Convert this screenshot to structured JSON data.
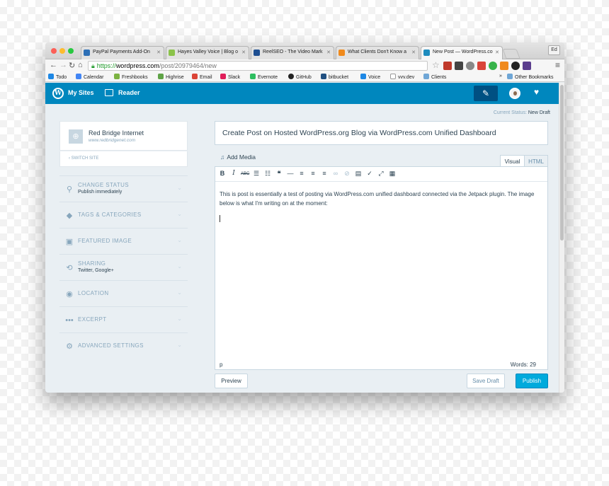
{
  "browser": {
    "tabs": [
      {
        "label": "PayPal Payments Add-On",
        "color": "#2d6fb6"
      },
      {
        "label": "Hayes Valley Voice | Blog o",
        "color": "#8bc34a"
      },
      {
        "label": "ReelSEO - The Video Mark",
        "color": "#1e4f91"
      },
      {
        "label": "What Clients Don't Know a",
        "color": "#f08a1c"
      },
      {
        "label": "New Post — WordPress.co",
        "color": "#1e8cbe"
      }
    ],
    "profile": "Ed",
    "url": {
      "scheme": "https://",
      "host": "wordpress.com",
      "path": "/post/20979464/new"
    },
    "bookmarks": [
      "Todo",
      "Calendar",
      "Freshbooks",
      "Highrise",
      "Email",
      "Slack",
      "Evernote",
      "GitHub",
      "bitbucket",
      "Voice",
      "vvv.dev",
      "Clients"
    ],
    "bookmarks_overflow": "»",
    "other_bookmarks": "Other Bookmarks"
  },
  "masterbar": {
    "my_sites": "My Sites",
    "reader": "Reader"
  },
  "status": {
    "label": "Current Status:",
    "value": "New Draft"
  },
  "site": {
    "name": "Red Bridge Internet",
    "url": "www.redbridgenet.com",
    "switch_label": "SWITCH SITE"
  },
  "sidebar": [
    {
      "title": "CHANGE STATUS",
      "subtitle": "Publish immediately",
      "icon": "pin-icon"
    },
    {
      "title": "TAGS & CATEGORIES",
      "subtitle": "",
      "icon": "tag-icon"
    },
    {
      "title": "FEATURED IMAGE",
      "subtitle": "",
      "icon": "image-icon"
    },
    {
      "title": "SHARING",
      "subtitle": "Twitter, Google+",
      "icon": "share-icon"
    },
    {
      "title": "LOCATION",
      "subtitle": "",
      "icon": "location-icon"
    },
    {
      "title": "EXCERPT",
      "subtitle": "",
      "icon": "ellipsis-icon"
    },
    {
      "title": "ADVANCED SETTINGS",
      "subtitle": "",
      "icon": "cog-icon"
    }
  ],
  "editor": {
    "title": "Create Post on Hosted WordPress.org Blog via WordPress.com Unified Dashboard",
    "add_media": "Add Media",
    "mode_visual": "Visual",
    "mode_html": "HTML",
    "content": "This is post is essentially a test of posting via WordPress.com unified dashboard connected via the Jetpack plugin. The image below is what I'm writing on at the moment:",
    "path": "p",
    "word_count": "Words: 29"
  },
  "actions": {
    "preview": "Preview",
    "save_draft": "Save Draft",
    "publish": "Publish"
  },
  "colors": {
    "masterbar": "#0087be",
    "publish": "#00aadc",
    "background": "#e9eff3"
  }
}
